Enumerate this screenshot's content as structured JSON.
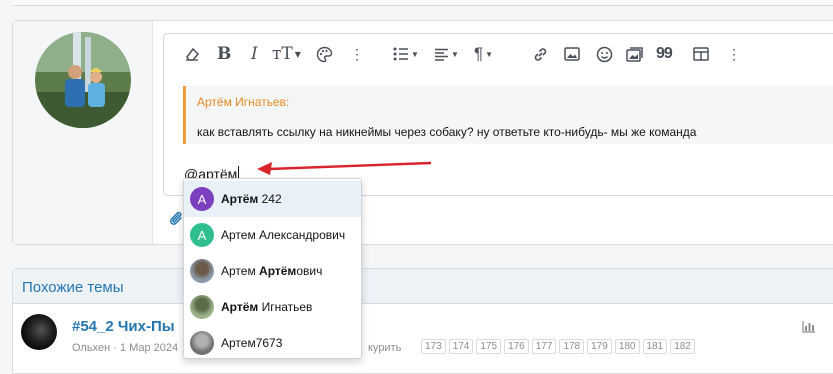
{
  "editor": {
    "toolbar": [
      {
        "name": "remove-format-icon"
      },
      {
        "name": "bold-icon",
        "label": "B"
      },
      {
        "name": "italic-icon",
        "label": "I"
      },
      {
        "name": "font-size-icon",
        "label": "тT"
      },
      {
        "name": "color-palette-icon"
      },
      {
        "name": "more-vertical-icon"
      },
      {
        "name": "list-icon"
      },
      {
        "name": "align-icon"
      },
      {
        "name": "paragraph-icon",
        "label": "¶"
      },
      {
        "name": "link-icon"
      },
      {
        "name": "image-icon"
      },
      {
        "name": "smilie-icon"
      },
      {
        "name": "media-icon"
      },
      {
        "name": "quote-icon",
        "label": "99"
      },
      {
        "name": "table-icon"
      },
      {
        "name": "more-vertical-icon-2"
      }
    ],
    "quote": {
      "author": "Артём Игнатьев:",
      "text": "как вставлять ссылку на никнеймы через собаку? ну ответьте кто-нибудь- мы же команда"
    },
    "input_value": "@артём"
  },
  "mention_suggestions": [
    {
      "initial": "А",
      "avatar_color": "#7b3fbf",
      "bold": "Артём",
      "rest": " 242",
      "active": true
    },
    {
      "initial": "А",
      "avatar_color": "#2fbf8f",
      "pre": "Артем Александрович",
      "active": false
    },
    {
      "photo": true,
      "pre": "Артем ",
      "bold": "Артём",
      "rest": "ович",
      "active": false
    },
    {
      "photo": true,
      "bold": "Артём",
      "rest": " Игнатьев",
      "active": false
    },
    {
      "photo": true,
      "pre": "Артем7673",
      "active": false
    }
  ],
  "related": {
    "title": "Похожие темы",
    "thread_title": "#54_2 Чих-Пы",
    "thread_meta": "Ольхен · 1 Мар 2024",
    "thread_snippet": "курить",
    "pages": [
      "173",
      "174",
      "175",
      "176",
      "177",
      "178",
      "179",
      "180",
      "181",
      "182"
    ]
  },
  "colors": {
    "accent": "#2577b1",
    "quote_border": "#f29e3d",
    "arrow": "#d9232a"
  }
}
